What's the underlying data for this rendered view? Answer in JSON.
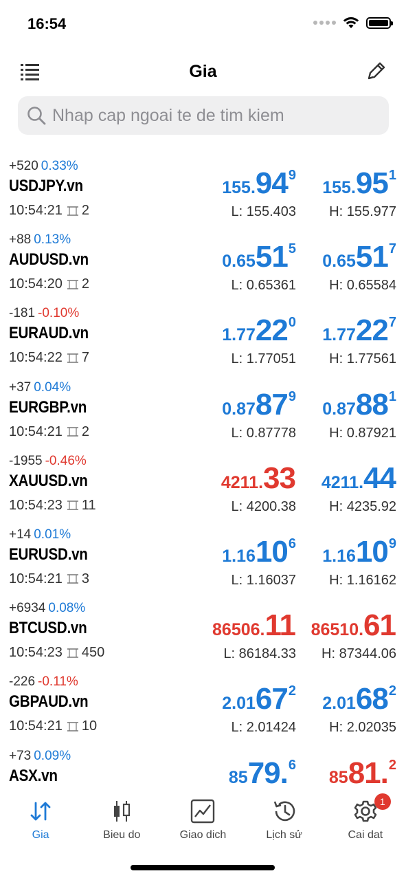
{
  "status_bar": {
    "time": "16:54"
  },
  "nav": {
    "title": "Gia"
  },
  "search": {
    "placeholder": "Nhap cap ngoai te de tim kiem"
  },
  "colors": {
    "accent": "#1e7ad6",
    "up": "#1e7ad6",
    "down": "#e0392f"
  },
  "quotes": [
    {
      "change": "+520",
      "pct": "0.33%",
      "dir": "up",
      "symbol": "USDJPY.vn",
      "time": "10:54:21",
      "spread": "2",
      "bid": {
        "small": "155.",
        "big": "94",
        "sup": "9",
        "color": "blue"
      },
      "ask": {
        "small": "155.",
        "big": "95",
        "sup": "1",
        "color": "blue"
      },
      "low": "L: 155.403",
      "high": "H: 155.977"
    },
    {
      "change": "+88",
      "pct": "0.13%",
      "dir": "up",
      "symbol": "AUDUSD.vn",
      "time": "10:54:20",
      "spread": "2",
      "bid": {
        "small": "0.65",
        "big": "51",
        "sup": "5",
        "color": "blue"
      },
      "ask": {
        "small": "0.65",
        "big": "51",
        "sup": "7",
        "color": "blue"
      },
      "low": "L: 0.65361",
      "high": "H: 0.65584"
    },
    {
      "change": "-181",
      "pct": "-0.10%",
      "dir": "down",
      "symbol": "EURAUD.vn",
      "time": "10:54:22",
      "spread": "7",
      "bid": {
        "small": "1.77",
        "big": "22",
        "sup": "0",
        "color": "blue"
      },
      "ask": {
        "small": "1.77",
        "big": "22",
        "sup": "7",
        "color": "blue"
      },
      "low": "L: 1.77051",
      "high": "H: 1.77561"
    },
    {
      "change": "+37",
      "pct": "0.04%",
      "dir": "up",
      "symbol": "EURGBP.vn",
      "time": "10:54:21",
      "spread": "2",
      "bid": {
        "small": "0.87",
        "big": "87",
        "sup": "9",
        "color": "blue"
      },
      "ask": {
        "small": "0.87",
        "big": "88",
        "sup": "1",
        "color": "blue"
      },
      "low": "L: 0.87778",
      "high": "H: 0.87921"
    },
    {
      "change": "-1955",
      "pct": "-0.46%",
      "dir": "down",
      "symbol": "XAUUSD.vn",
      "time": "10:54:23",
      "spread": "11",
      "bid": {
        "small": "4211.",
        "big": "33",
        "sup": "",
        "color": "red"
      },
      "ask": {
        "small": "4211.",
        "big": "44",
        "sup": "",
        "color": "blue"
      },
      "low": "L: 4200.38",
      "high": "H: 4235.92"
    },
    {
      "change": "+14",
      "pct": "0.01%",
      "dir": "up",
      "symbol": "EURUSD.vn",
      "time": "10:54:21",
      "spread": "3",
      "bid": {
        "small": "1.16",
        "big": "10",
        "sup": "6",
        "color": "blue"
      },
      "ask": {
        "small": "1.16",
        "big": "10",
        "sup": "9",
        "color": "blue"
      },
      "low": "L: 1.16037",
      "high": "H: 1.16162"
    },
    {
      "change": "+6934",
      "pct": "0.08%",
      "dir": "up",
      "symbol": "BTCUSD.vn",
      "time": "10:54:23",
      "spread": "450",
      "bid": {
        "small": "86506.",
        "big": "11",
        "sup": "",
        "color": "red"
      },
      "ask": {
        "small": "86510.",
        "big": "61",
        "sup": "",
        "color": "red"
      },
      "low": "L: 86184.33",
      "high": "H: 87344.06"
    },
    {
      "change": "-226",
      "pct": "-0.11%",
      "dir": "down",
      "symbol": "GBPAUD.vn",
      "time": "10:54:21",
      "spread": "10",
      "bid": {
        "small": "2.01",
        "big": "67",
        "sup": "2",
        "color": "blue"
      },
      "ask": {
        "small": "2.01",
        "big": "68",
        "sup": "2",
        "color": "blue"
      },
      "low": "L: 2.01424",
      "high": "H: 2.02035"
    },
    {
      "change": "+73",
      "pct": "0.09%",
      "dir": "up",
      "symbol": "ASX.vn",
      "time": "",
      "spread": "",
      "bid": {
        "small": "85",
        "big": "79.",
        "sup": "6",
        "color": "blue"
      },
      "ask": {
        "small": "85",
        "big": "81.",
        "sup": "2",
        "color": "red"
      },
      "low": "",
      "high": ""
    }
  ],
  "tabs": [
    {
      "label": "Gia",
      "icon": "arrows-updown-icon",
      "active": true
    },
    {
      "label": "Bieu do",
      "icon": "candlestick-icon",
      "active": false
    },
    {
      "label": "Giao dich",
      "icon": "trade-chart-icon",
      "active": false
    },
    {
      "label": "Lịch sử",
      "icon": "history-icon",
      "active": false
    },
    {
      "label": "Cai dat",
      "icon": "gear-icon",
      "active": false,
      "badge": "1"
    }
  ]
}
